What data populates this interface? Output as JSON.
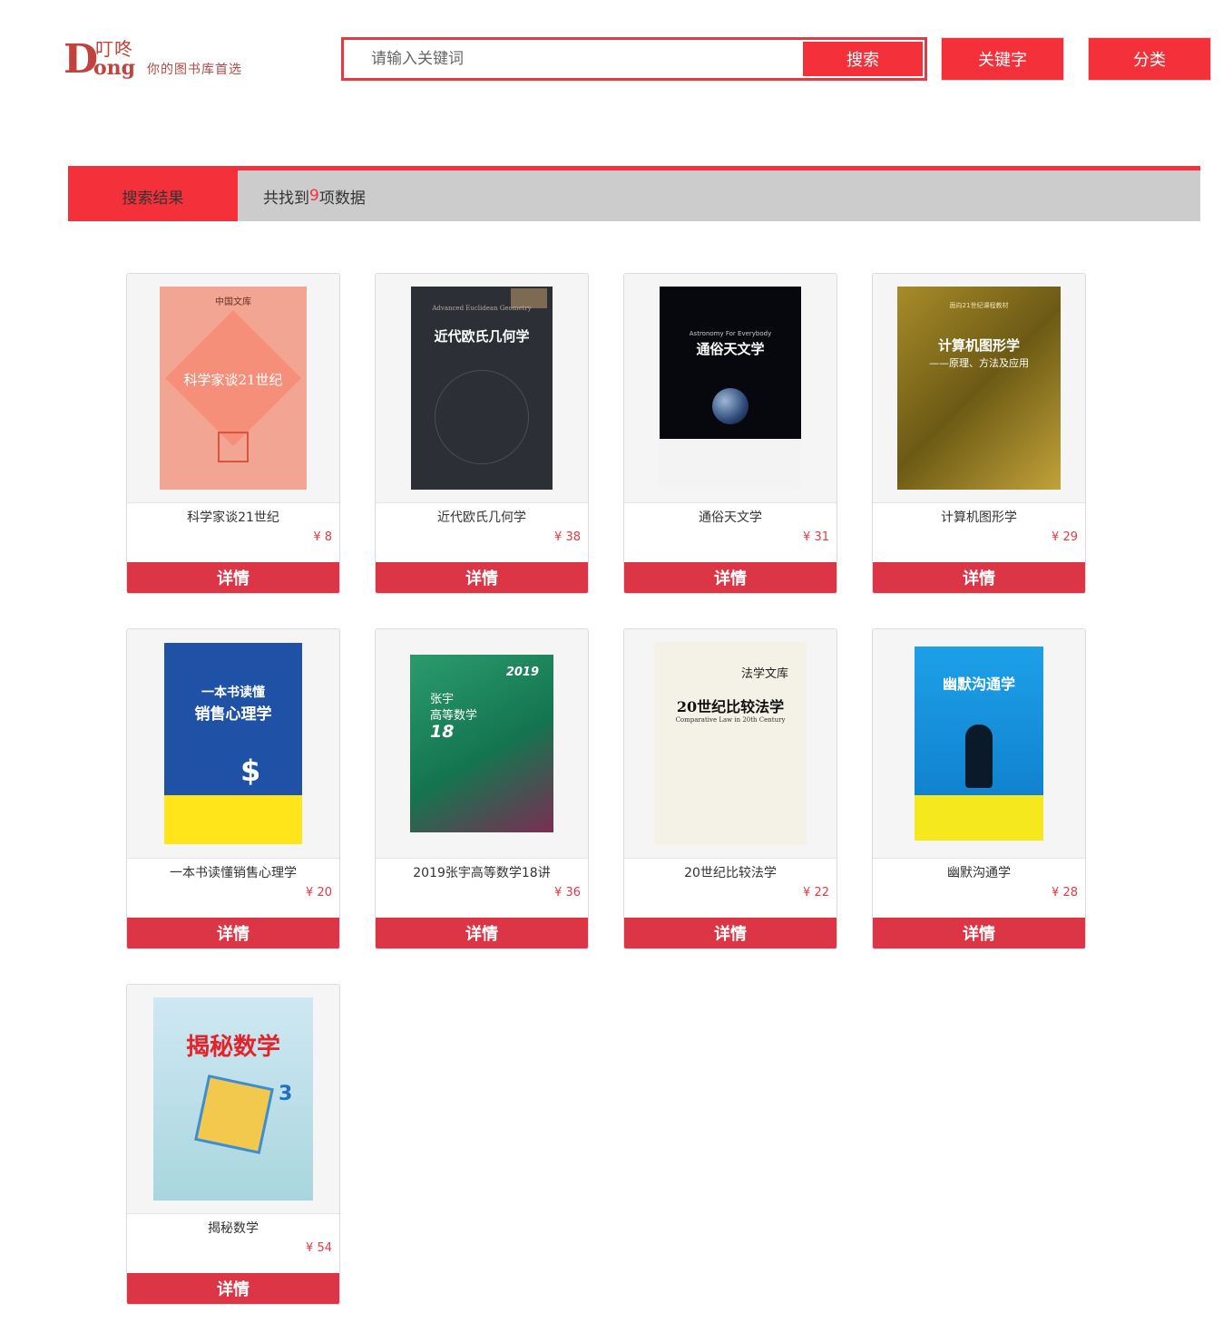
{
  "header": {
    "logo_cn": "叮咚",
    "logo_d": "D",
    "logo_ong": "ong",
    "logo_slogan": "你的图书库首选",
    "search_placeholder": "请输入关键词",
    "search_button": "搜索",
    "keyword_button": "关键字",
    "category_button": "分类"
  },
  "results": {
    "tab_label": "搜索结果",
    "count_prefix": "共找到 ",
    "count": "9",
    "count_suffix": "项数据"
  },
  "books": [
    {
      "title": "科学家谈21世纪",
      "price": "¥ 8",
      "detail": "详情"
    },
    {
      "title": "近代欧氏几何学",
      "price": "¥ 38",
      "detail": "详情"
    },
    {
      "title": "通俗天文学",
      "price": "¥ 31",
      "detail": "详情"
    },
    {
      "title": "计算机图形学",
      "price": "¥ 29",
      "detail": "详情"
    },
    {
      "title": "一本书读懂销售心理学",
      "price": "¥ 20",
      "detail": "详情"
    },
    {
      "title": "2019张宇高等数学18讲",
      "price": "¥ 36",
      "detail": "详情"
    },
    {
      "title": "20世纪比较法学",
      "price": "¥ 22",
      "detail": "详情"
    },
    {
      "title": "幽默沟通学",
      "price": "¥ 28",
      "detail": "详情"
    },
    {
      "title": "揭秘数学",
      "price": "¥ 54",
      "detail": "详情"
    }
  ],
  "covers": {
    "c1_series": "中国文库",
    "c1_title": "科学家谈21世纪",
    "c2_en": "Advanced Euclidean Geometry",
    "c2_title": "近代欧氏几何学",
    "c3_en": "Astronomy For Everybody",
    "c3_title": "通俗天文学",
    "c4_series": "面向21世纪课程教材",
    "c4_title": "计算机图形学",
    "c4_sub": "——原理、方法及应用",
    "c5_title": "一本书读懂",
    "c5_title2": "销售心理学",
    "c6_year": "2019",
    "c6_author": "张宇",
    "c6_title": "高等数学",
    "c6_num": "18",
    "c7_series": "法学文库",
    "c7_title": "20世纪比较法学",
    "c7_en": "Comparative Law in 20th Century",
    "c8_title": "幽默沟通学",
    "c9_title": "揭秘数学"
  },
  "colors": {
    "accent": "#f4303a",
    "detail_button": "#dc3545",
    "price": "#e23b44",
    "bar_gray": "#cccccc"
  }
}
